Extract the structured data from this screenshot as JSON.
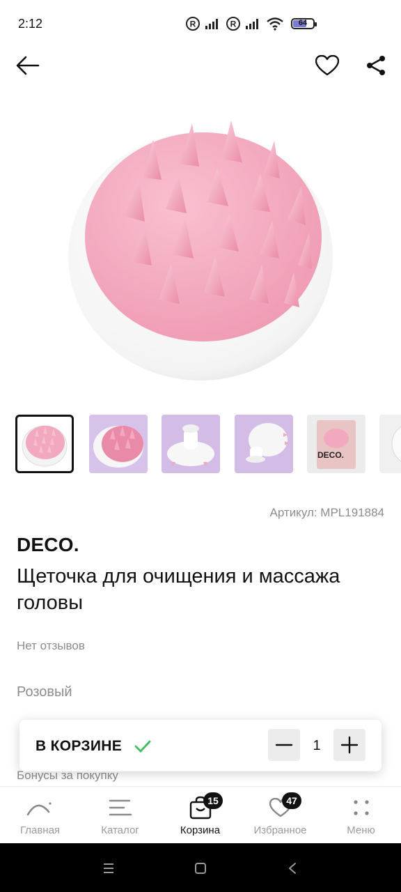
{
  "status_bar": {
    "time": "2:12",
    "battery": "64"
  },
  "toolbar": {
    "back_icon": "arrow-left-icon",
    "favorite_icon": "heart-icon",
    "share_icon": "share-icon"
  },
  "product": {
    "article_label": "Артикул: MPL191884",
    "brand": "DECO.",
    "title": "Щеточка для очищения и массажа головы",
    "reviews": "Нет отзывов",
    "color": "Розовый",
    "bonus_label": "Бонусы за покупку",
    "thumbnails": [
      {
        "name": "thumb-front",
        "active": true
      },
      {
        "name": "thumb-angle-pink"
      },
      {
        "name": "thumb-handle"
      },
      {
        "name": "thumb-back"
      },
      {
        "name": "thumb-package",
        "text": "DECO."
      },
      {
        "name": "thumb-more"
      }
    ]
  },
  "cart": {
    "in_cart_label": "В КОРЗИНЕ",
    "quantity": "1",
    "check_color": "#3fbf5f"
  },
  "bottom_nav": [
    {
      "label": "Главная",
      "icon": "home-arc-icon"
    },
    {
      "label": "Каталог",
      "icon": "catalog-lines-icon"
    },
    {
      "label": "Корзина",
      "icon": "cart-icon",
      "badge": "15",
      "active": true
    },
    {
      "label": "Избранное",
      "icon": "heart-icon",
      "badge": "47"
    },
    {
      "label": "Меню",
      "icon": "dots-grid-icon"
    }
  ],
  "colors": {
    "brush_pink": "#f4a9bf",
    "brush_shell": "#ffffff",
    "text_primary": "#111111",
    "text_muted": "#8c8c8c"
  }
}
